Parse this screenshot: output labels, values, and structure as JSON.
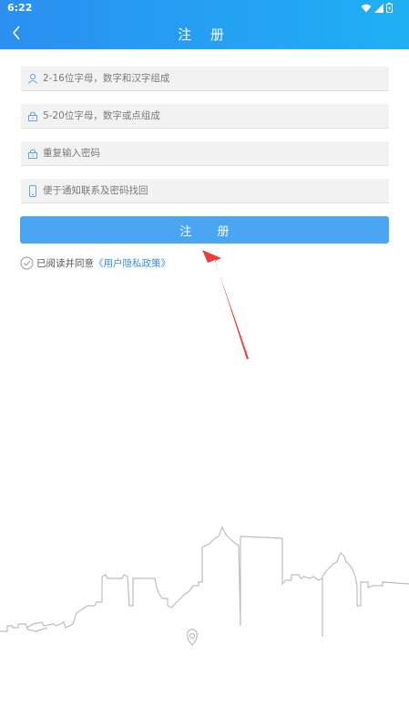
{
  "status": {
    "time": "6:22"
  },
  "header": {
    "title": "注 册"
  },
  "form": {
    "username_placeholder": "2-16位字母，数字和汉字组成",
    "password_placeholder": "5-20位字母，数字或点组成",
    "confirm_placeholder": "重复输入密码",
    "phone_placeholder": "便于通知联系及密码找回",
    "submit_label": "注 册"
  },
  "agreement": {
    "prefix": "已阅读并同意",
    "link": "《用户隐私政策》"
  },
  "colors": {
    "header_start": "#2b8ff0",
    "header_end": "#1fb0f5",
    "button": "#4aa5f2",
    "link": "#3a8fe0",
    "arrow": "#ef3b3b"
  },
  "icons": [
    "back-arrow-icon",
    "wifi-icon",
    "signal-icon",
    "battery-icon",
    "user-icon",
    "lock-icon",
    "phone-icon",
    "check-circle-icon",
    "location-pin-icon"
  ]
}
